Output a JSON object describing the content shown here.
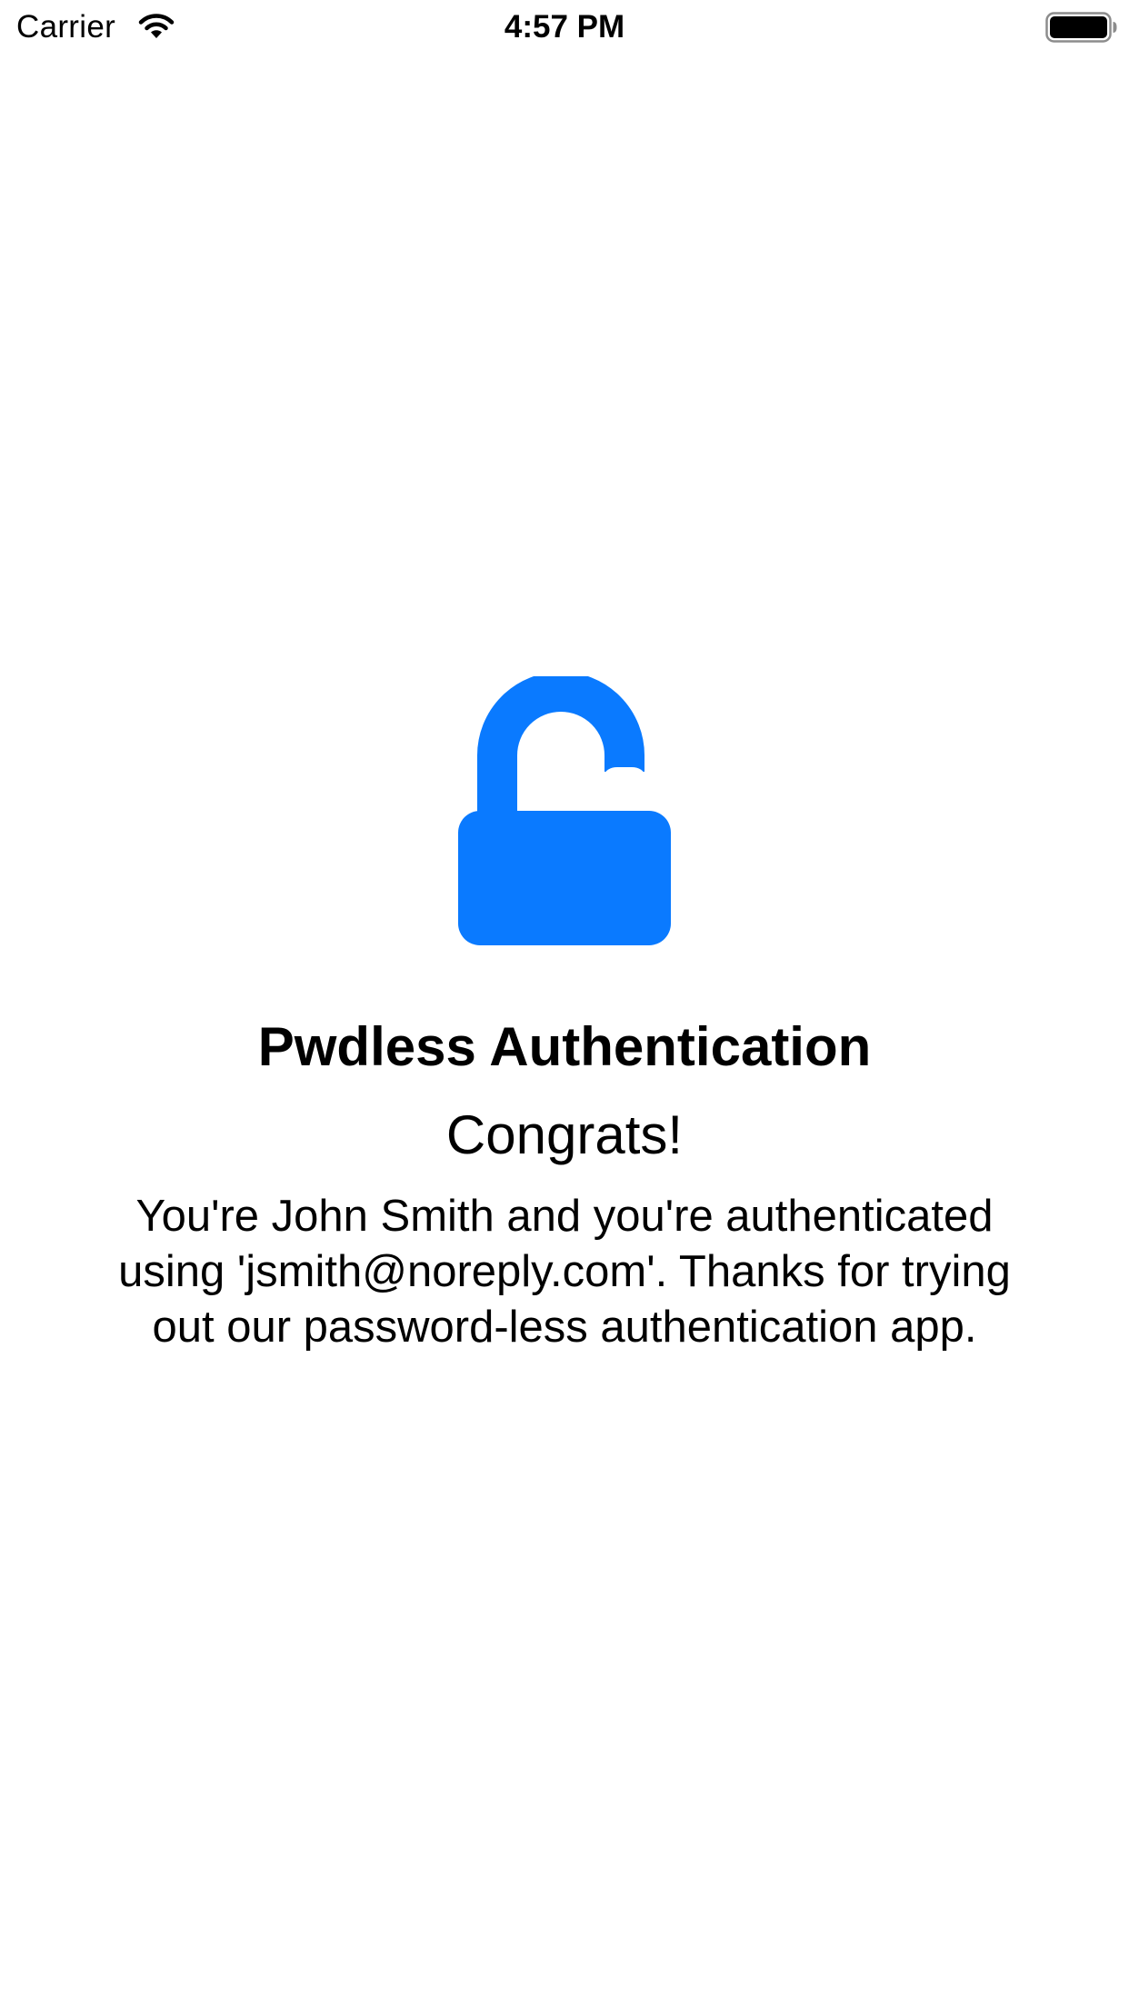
{
  "status_bar": {
    "carrier": "Carrier",
    "time": "4:57 PM",
    "wifi_icon": "wifi-icon",
    "battery_icon": "battery-full-icon"
  },
  "main": {
    "icon": "lock-open-icon",
    "icon_color": "#0A7AFF",
    "title": "Pwdless Authentication",
    "subtitle": "Congrats!",
    "message": "You're John Smith and you're authenticated\nusing 'jsmith@noreply.com'.  Thanks for trying\nout our password-less authentication app."
  }
}
